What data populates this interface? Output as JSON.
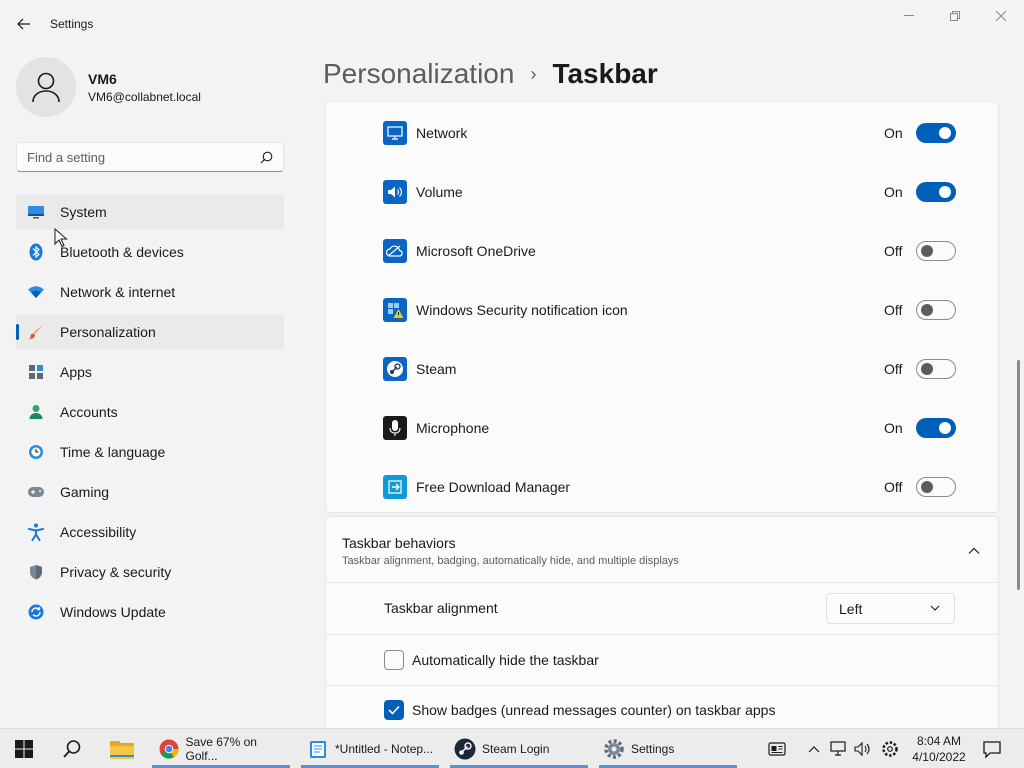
{
  "window": {
    "title": "Settings"
  },
  "profile": {
    "name": "VM6",
    "email": "VM6@collabnet.local"
  },
  "search": {
    "placeholder": "Find a setting"
  },
  "nav": {
    "items": [
      {
        "label": "System",
        "icon": "monitor-icon"
      },
      {
        "label": "Bluetooth & devices",
        "icon": "bluetooth-icon"
      },
      {
        "label": "Network & internet",
        "icon": "wifi-icon"
      },
      {
        "label": "Personalization",
        "icon": "brush-icon"
      },
      {
        "label": "Apps",
        "icon": "apps-icon"
      },
      {
        "label": "Accounts",
        "icon": "person-icon"
      },
      {
        "label": "Time & language",
        "icon": "clock-globe-icon"
      },
      {
        "label": "Gaming",
        "icon": "gamepad-icon"
      },
      {
        "label": "Accessibility",
        "icon": "accessibility-icon"
      },
      {
        "label": "Privacy & security",
        "icon": "shield-icon"
      },
      {
        "label": "Windows Update",
        "icon": "update-icon"
      }
    ],
    "selected": "Personalization"
  },
  "breadcrumb": {
    "parent": "Personalization",
    "separator": "›",
    "current": "Taskbar"
  },
  "tray_icons": [
    {
      "label": "Network",
      "state": "On",
      "on": true
    },
    {
      "label": "Volume",
      "state": "On",
      "on": true
    },
    {
      "label": "Microsoft OneDrive",
      "state": "Off",
      "on": false
    },
    {
      "label": "Windows Security notification icon",
      "state": "Off",
      "on": false
    },
    {
      "label": "Steam",
      "state": "Off",
      "on": false
    },
    {
      "label": "Microphone",
      "state": "On",
      "on": true
    },
    {
      "label": "Free Download Manager",
      "state": "Off",
      "on": false
    }
  ],
  "behaviors": {
    "title": "Taskbar behaviors",
    "subtitle": "Taskbar alignment, badging, automatically hide, and multiple displays",
    "alignment": {
      "label": "Taskbar alignment",
      "value": "Left"
    },
    "auto_hide": {
      "label": "Automatically hide the taskbar",
      "checked": false
    },
    "badges": {
      "label": "Show badges (unread messages counter) on taskbar apps",
      "checked": true
    }
  },
  "taskbar": {
    "apps": [
      {
        "label": "Save 67% on Golf...",
        "icon": "chrome-icon"
      },
      {
        "label": "*Untitled - Notep...",
        "icon": "notepad-icon"
      },
      {
        "label": "Steam Login",
        "icon": "steam-icon"
      },
      {
        "label": "Settings",
        "icon": "settings-gear-icon"
      }
    ],
    "time": "8:04 AM",
    "date": "4/10/2022"
  },
  "colors": {
    "accent": "#005fb8",
    "background": "#f3f3f3",
    "card": "#fbfbfb"
  }
}
